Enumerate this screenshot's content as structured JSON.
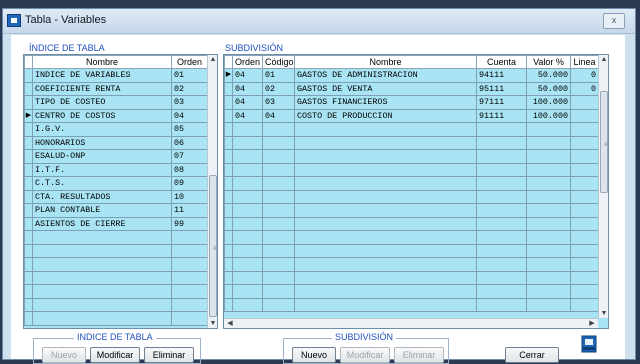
{
  "window": {
    "title": "Tabla - Variables",
    "close_label": "x"
  },
  "indice": {
    "section_label": "ÍNDICE DE TABLA",
    "columns": [
      "Nombre",
      "Orden"
    ],
    "current_row": 3,
    "rows": [
      [
        "INDICE DE VARIABLES",
        "01"
      ],
      [
        "COEFICIENTE RENTA",
        "02"
      ],
      [
        "TIPO DE COSTEO",
        "03"
      ],
      [
        "CENTRO DE COSTOS",
        "04"
      ],
      [
        "I.G.V.",
        "05"
      ],
      [
        "HONORARIOS",
        "06"
      ],
      [
        "ESALUD-ONP",
        "07"
      ],
      [
        "I.T.F.",
        "08"
      ],
      [
        "C.T.S.",
        "09"
      ],
      [
        "CTA. RESULTADOS",
        "10"
      ],
      [
        "PLAN CONTABLE",
        "11"
      ],
      [
        "ASIENTOS DE CIERRE",
        "99"
      ]
    ]
  },
  "subdivision": {
    "section_label": "SUBDIVISIÓN",
    "columns": [
      "Orden",
      "Código",
      "Nombre",
      "Cuenta",
      "Valor %",
      "Linea"
    ],
    "current_row": 0,
    "rows": [
      [
        "04",
        "01",
        "GASTOS DE ADMINISTRACION",
        "94111",
        "50.000",
        "0"
      ],
      [
        "04",
        "02",
        "GASTOS DE VENTA",
        "95111",
        "50.000",
        "0"
      ],
      [
        "04",
        "03",
        "GASTOS FINANCIEROS",
        "97111",
        "100.000",
        ""
      ],
      [
        "04",
        "04",
        "COSTO DE PRODUCCION",
        "91111",
        "100.000",
        ""
      ]
    ]
  },
  "buttons": {
    "indice_group": "INDICE DE TABLA",
    "subdivision_group": "SUBDIVISIÓN",
    "nuevo": "Nuevo",
    "modificar": "Modificar",
    "eliminar": "Eliminar",
    "cerrar": "Cerrar"
  },
  "colors": {
    "grid": "#a8e4f3",
    "section_label": "#1f4fc0"
  }
}
